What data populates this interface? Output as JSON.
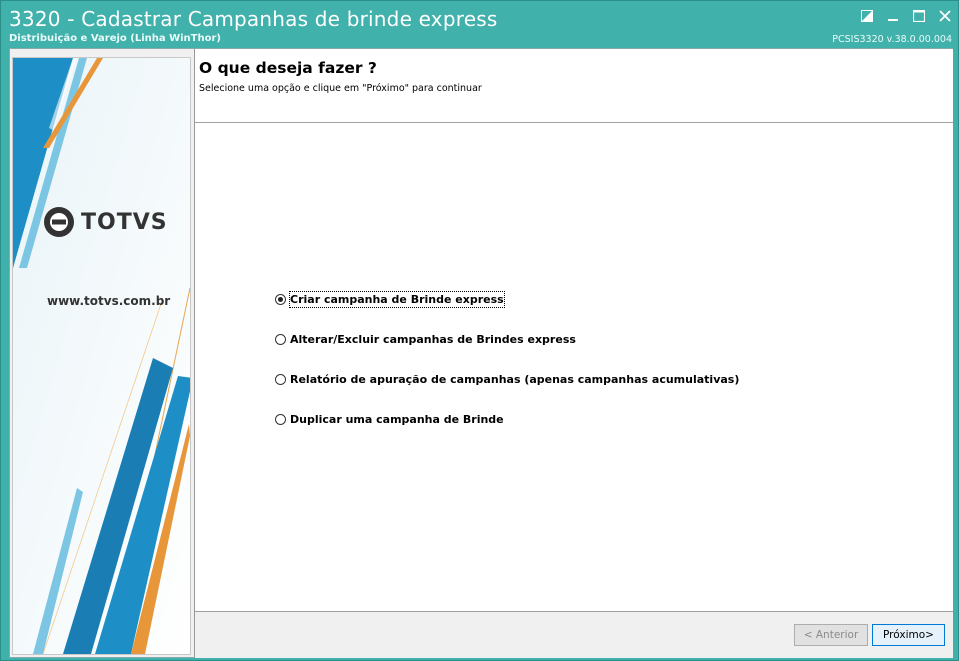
{
  "window": {
    "title": "3320 - Cadastrar Campanhas de brinde express",
    "subtitle": "Distribuição e Varejo (Linha WinThor)",
    "version": "PCSIS3320  v.38.0.00.004"
  },
  "banner": {
    "logo_text": "TOTVS",
    "url": "www.totvs.com.br"
  },
  "wizard": {
    "heading": "O que deseja fazer ?",
    "instruction": "Selecione uma opção e clique em \"Próximo\" para continuar",
    "options": [
      {
        "label": "Criar campanha de Brinde express",
        "selected": true
      },
      {
        "label": "Alterar/Excluir campanhas de Brindes express",
        "selected": false
      },
      {
        "label": "Relatório de apuração de campanhas (apenas campanhas acumulativas)",
        "selected": false
      },
      {
        "label": "Duplicar uma campanha de Brinde",
        "selected": false
      }
    ],
    "prev_label": "< Anterior",
    "next_label": "Próximo>"
  },
  "colors": {
    "titlebar": "#41b1ab",
    "accent_blue": "#1a8fc9",
    "accent_orange": "#e8963a"
  }
}
